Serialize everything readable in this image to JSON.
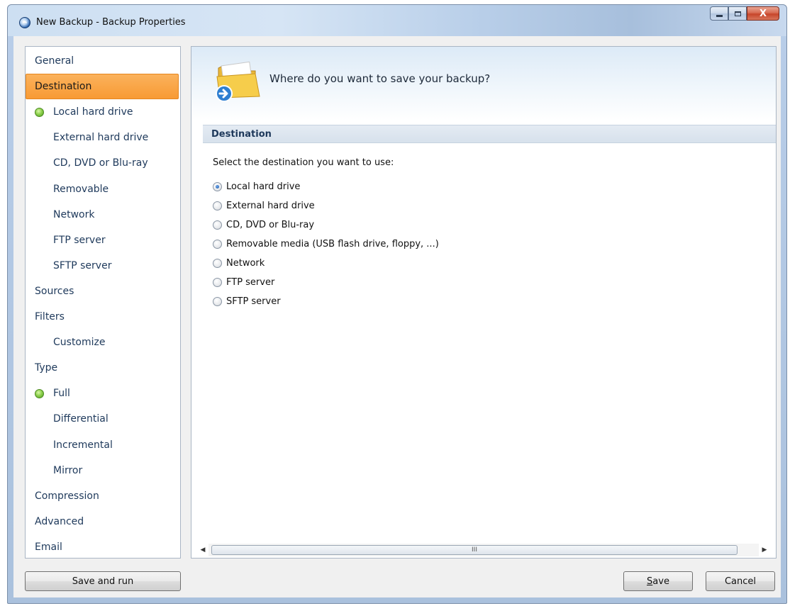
{
  "window": {
    "title": "New Backup - Backup Properties",
    "controls": {
      "minimize": "",
      "maximize": "",
      "close": "X"
    }
  },
  "nav": {
    "items": [
      {
        "label": "General",
        "level": 0
      },
      {
        "label": "Destination",
        "level": 0,
        "selected": true
      },
      {
        "label": "Local hard drive",
        "level": 1,
        "active": true
      },
      {
        "label": "External hard drive",
        "level": 1
      },
      {
        "label": "CD, DVD or Blu-ray",
        "level": 1
      },
      {
        "label": "Removable",
        "level": 1
      },
      {
        "label": "Network",
        "level": 1
      },
      {
        "label": "FTP server",
        "level": 1
      },
      {
        "label": "SFTP server",
        "level": 1
      },
      {
        "label": "Sources",
        "level": 0
      },
      {
        "label": "Filters",
        "level": 0
      },
      {
        "label": "Customize",
        "level": 1
      },
      {
        "label": "Type",
        "level": 0
      },
      {
        "label": "Full",
        "level": 1,
        "active": true
      },
      {
        "label": "Differential",
        "level": 1
      },
      {
        "label": "Incremental",
        "level": 1
      },
      {
        "label": "Mirror",
        "level": 1
      },
      {
        "label": "Compression",
        "level": 0
      },
      {
        "label": "Advanced",
        "level": 0
      },
      {
        "label": "Email",
        "level": 0
      }
    ]
  },
  "main": {
    "question": "Where do you want to save your backup?",
    "section_title": "Destination",
    "instruction": "Select the destination you want to use:",
    "options": [
      {
        "label": "Local hard drive",
        "checked": true
      },
      {
        "label": "External hard drive",
        "checked": false
      },
      {
        "label": "CD, DVD or Blu-ray",
        "checked": false
      },
      {
        "label": "Removable media (USB flash drive, floppy, ...)",
        "checked": false
      },
      {
        "label": "Network",
        "checked": false
      },
      {
        "label": "FTP server",
        "checked": false
      },
      {
        "label": "SFTP server",
        "checked": false
      }
    ],
    "scrollbar_grip": "III"
  },
  "footer": {
    "save_and_run": "Save and run",
    "save_prefix": "S",
    "save_rest": "ave",
    "cancel": "Cancel"
  },
  "colors": {
    "selected_nav": "#f89a34",
    "nav_text": "#1e395b",
    "active_dot": "#8fd14f"
  },
  "icons": {
    "app": "backup-app-icon",
    "header": "folder-arrow-icon",
    "active_marker": "green-dot-icon"
  }
}
